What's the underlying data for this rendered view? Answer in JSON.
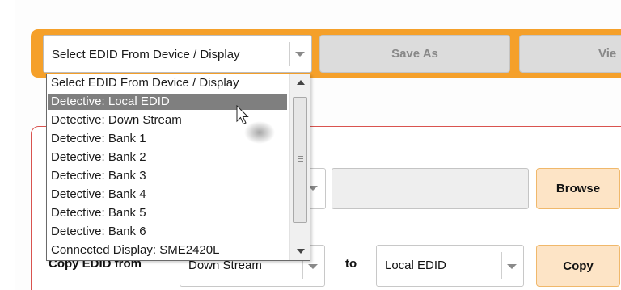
{
  "toolbar": {
    "edid_source_select": {
      "value": "Select EDID From Device / Display"
    },
    "save_as_label": "Save As",
    "view_label_partial": "Vie"
  },
  "dropdown": {
    "items": [
      {
        "label": "Select EDID From Device / Display",
        "selected": false
      },
      {
        "label": "Detective: Local EDID",
        "selected": true
      },
      {
        "label": "Detective: Down Stream",
        "selected": false
      },
      {
        "label": "Detective: Bank 1",
        "selected": false
      },
      {
        "label": "Detective: Bank 2",
        "selected": false
      },
      {
        "label": "Detective: Bank 3",
        "selected": false
      },
      {
        "label": "Detective: Bank 4",
        "selected": false
      },
      {
        "label": "Detective: Bank 5",
        "selected": false
      },
      {
        "label": "Detective: Bank 6",
        "selected": false
      },
      {
        "label": "Connected Display: SME2420L",
        "selected": false
      }
    ]
  },
  "browse": {
    "button_label": "Browse"
  },
  "copy_row": {
    "label": "Copy EDID from",
    "from_value": "Down Stream",
    "to_label": "to",
    "to_value": "Local EDID",
    "button_label": "Copy"
  },
  "colors": {
    "toolbar_orange": "#f5a02a",
    "panel_border_red": "#d9534f",
    "orange_button_fill": "#fde4c6",
    "selected_item_gray": "#7f7f7f"
  }
}
